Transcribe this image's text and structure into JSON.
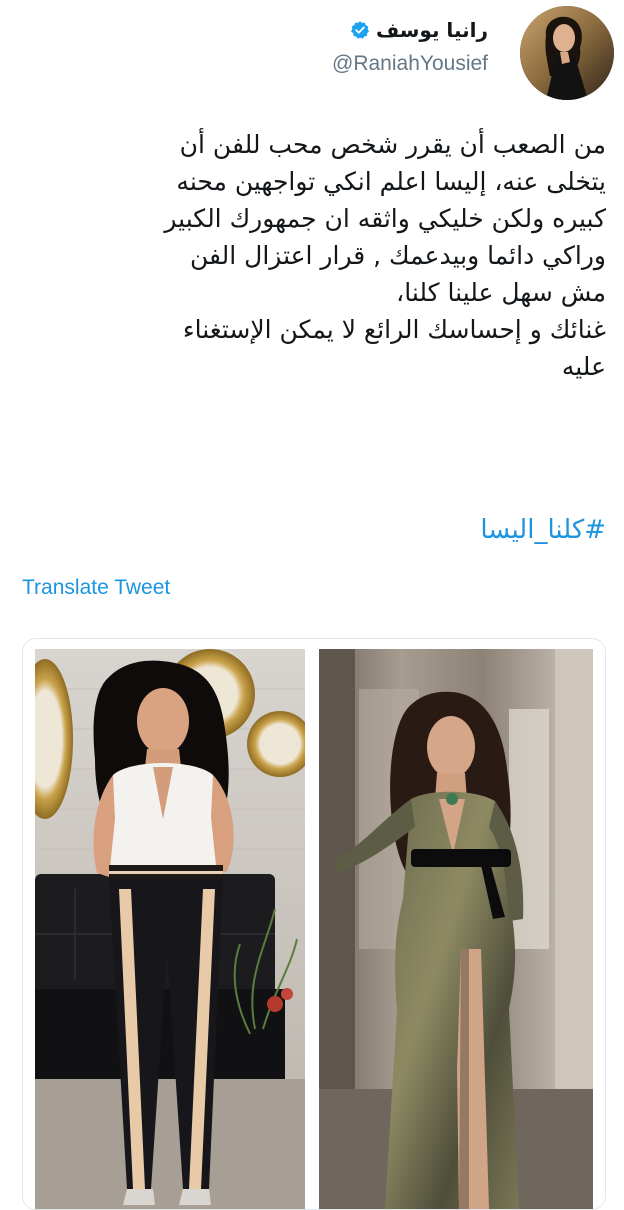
{
  "tweet": {
    "author": {
      "display_name": "رانيا يوسف",
      "handle": "@RaniahYousief",
      "verified": true,
      "avatar_icon": "avatar-photo"
    },
    "menu_icon": "chevron-down-icon",
    "text_lines": [
      "من الصعب أن يقرر شخص محب للفن أن",
      "يتخلى عنه، إليسا اعلم انكي تواجهين محنه",
      "كبيره ولكن خليكي واثقه ان جمهورك الكبير",
      "وراكي دائما وبيدعمك , قرار اعتزال الفن",
      "مش سهل علينا كلنا،",
      "غنائك و إحساسك الرائع  لا يمكن الإستغناء",
      "عليه"
    ],
    "hashtag": "#كلنا_اليسا",
    "translate_label": "Translate Tweet",
    "media": {
      "count": 2,
      "items": [
        "photo-woman-white-top",
        "photo-woman-sequin-gown"
      ]
    }
  },
  "colors": {
    "link": "#1b95e0",
    "text": "#14171a",
    "secondary": "#657786",
    "verified": "#1da1f2",
    "border": "#e1e8ed"
  }
}
